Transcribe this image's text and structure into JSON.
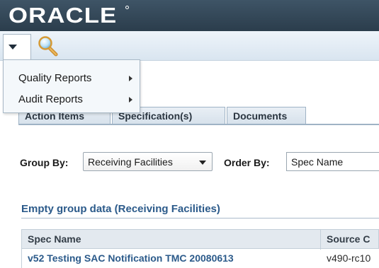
{
  "header": {
    "logo_text": "ORACLE"
  },
  "toolbar": {
    "menu_icon": "chevron-down-icon",
    "search_icon": "magnifier-icon"
  },
  "dropdown": {
    "items": [
      {
        "label": "Quality Reports"
      },
      {
        "label": "Audit Reports"
      }
    ]
  },
  "tabs": [
    {
      "label": "Action Items"
    },
    {
      "label": "Specification(s)"
    },
    {
      "label": "Documents"
    }
  ],
  "controls": {
    "group_by_label": "Group By:",
    "group_by_value": "Receiving Facilities",
    "order_by_label": "Order By:",
    "order_by_value": "Spec Name"
  },
  "section": {
    "title": "Empty group data (Receiving Facilities)"
  },
  "table": {
    "columns": [
      "Spec Name",
      "Source C"
    ],
    "rows": [
      [
        "v52 Testing SAC Notification TMC 20080613",
        "v490-rc10"
      ]
    ]
  },
  "colors": {
    "banner": "#2b3d4c",
    "link": "#2b5a8a",
    "toolbar": "#d9e5f0"
  }
}
